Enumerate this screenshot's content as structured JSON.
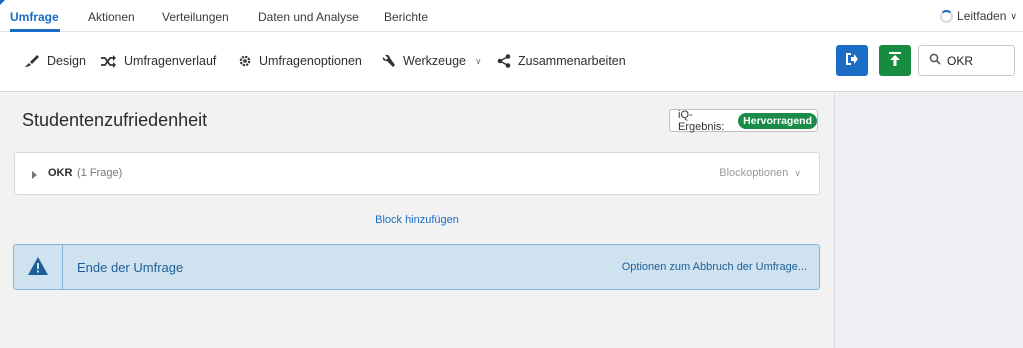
{
  "nav": {
    "tabs": [
      {
        "label": "Umfrage",
        "active": true
      },
      {
        "label": "Aktionen",
        "active": false
      },
      {
        "label": "Verteilungen",
        "active": false
      },
      {
        "label": "Daten und Analyse",
        "active": false
      },
      {
        "label": "Berichte",
        "active": false
      }
    ],
    "guide_label": "Leitfaden",
    "guide_chevron": "∨"
  },
  "toolbar": {
    "design": {
      "label": "Design",
      "icon": "brush-icon"
    },
    "history": {
      "label": "Umfragenverlauf",
      "icon": "shuffle-icon"
    },
    "options": {
      "label": "Umfragenoptionen",
      "icon": "gear-icon"
    },
    "tools": {
      "label": "Werkzeuge",
      "icon": "wrench-icon",
      "chevron": "∨"
    },
    "collab": {
      "label": "Zusammenarbeiten",
      "icon": "share-icon"
    },
    "search": {
      "value": "OKR",
      "icon": "search-icon"
    }
  },
  "survey": {
    "title": "Studentenzufriedenheit",
    "iq_label": "iQ-Ergebnis:",
    "iq_badge": "Hervorragend"
  },
  "block": {
    "name": "OKR",
    "count": "(1 Frage)",
    "options_label": "Blockoptionen",
    "options_chevron": "∨"
  },
  "add_block_label": "Block hinzufügen",
  "end": {
    "title": "Ende der Umfrage",
    "options_label": "Optionen zum Abbruch der Umfrage..."
  },
  "colors": {
    "accent_blue": "#1a6cc4",
    "accent_green": "#178b3f",
    "badge_green": "#1a8c48",
    "end_bar_bg": "#cfe2f0"
  }
}
